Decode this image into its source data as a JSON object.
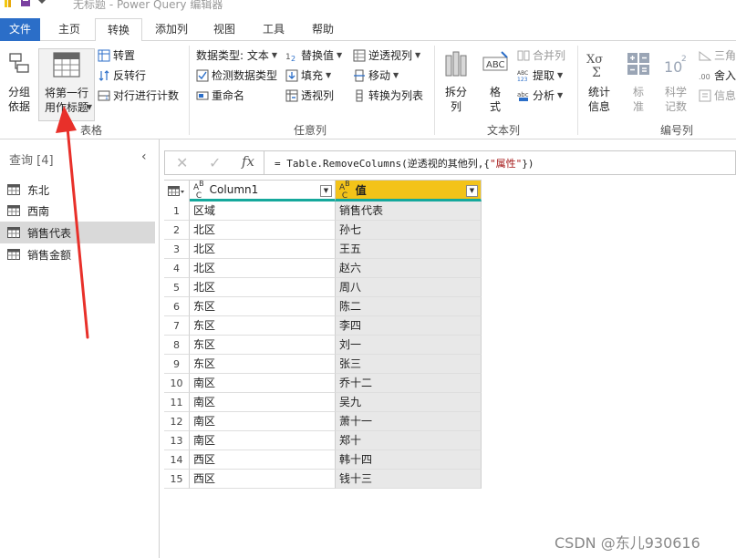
{
  "window": {
    "title": "无标题 - Power Query 编辑器"
  },
  "tabs": [
    {
      "label": "文件"
    },
    {
      "label": "主页"
    },
    {
      "label": "转换"
    },
    {
      "label": "添加列"
    },
    {
      "label": "视图"
    },
    {
      "label": "工具"
    },
    {
      "label": "帮助"
    }
  ],
  "ribbon": {
    "table_group": {
      "label": "表格",
      "group_by": "分组\n依据",
      "use_first_row": "将第一行\n用作标题",
      "transpose": "转置",
      "reverse_rows": "反转行",
      "count_rows": "对行进行计数"
    },
    "any_column_group": {
      "label": "任意列",
      "data_type": "数据类型: 文本",
      "detect_type": "检测数据类型",
      "rename": "重命名",
      "replace_values": "替换值",
      "fill": "填充",
      "pivot": "透视列",
      "unpivot": "逆透视列",
      "move": "移动",
      "to_list": "转换为列表"
    },
    "text_column_group": {
      "label": "文本列",
      "split": "拆分\n列",
      "format": "格\n式",
      "merge": "合并列",
      "extract": "提取",
      "parse": "分析"
    },
    "number_column_group": {
      "label": "编号列",
      "stats": "统计\n信息",
      "standard": "标\n准",
      "scientific": "科学\n记数",
      "trig": "三角",
      "round": "舍入",
      "info": "信息"
    }
  },
  "queries": {
    "title": "查询 [4]",
    "items": [
      {
        "label": "东北",
        "selected": false
      },
      {
        "label": "西南",
        "selected": false
      },
      {
        "label": "销售代表",
        "selected": true
      },
      {
        "label": "销售金额",
        "selected": false
      }
    ]
  },
  "formula": {
    "prefix": "= Table.RemoveColumns(逆透视的其他列,{",
    "string": "\"属性\"",
    "suffix": "})"
  },
  "grid": {
    "columns": [
      "Column1",
      "值"
    ],
    "rows": [
      {
        "n": "1",
        "c1": "区域",
        "c2": "销售代表"
      },
      {
        "n": "2",
        "c1": "北区",
        "c2": "孙七"
      },
      {
        "n": "3",
        "c1": "北区",
        "c2": "王五"
      },
      {
        "n": "4",
        "c1": "北区",
        "c2": "赵六"
      },
      {
        "n": "5",
        "c1": "北区",
        "c2": "周八"
      },
      {
        "n": "6",
        "c1": "东区",
        "c2": "陈二"
      },
      {
        "n": "7",
        "c1": "东区",
        "c2": "李四"
      },
      {
        "n": "8",
        "c1": "东区",
        "c2": "刘一"
      },
      {
        "n": "9",
        "c1": "东区",
        "c2": "张三"
      },
      {
        "n": "10",
        "c1": "南区",
        "c2": "乔十二"
      },
      {
        "n": "11",
        "c1": "南区",
        "c2": "吴九"
      },
      {
        "n": "12",
        "c1": "南区",
        "c2": "萧十一"
      },
      {
        "n": "13",
        "c1": "南区",
        "c2": "郑十"
      },
      {
        "n": "14",
        "c1": "西区",
        "c2": "韩十四"
      },
      {
        "n": "15",
        "c1": "西区",
        "c2": "钱十三"
      }
    ]
  },
  "watermark": "CSDN @东儿930616",
  "colors": {
    "accent": "#2b6ec8",
    "value_header": "#f3c319",
    "header_underline": "#15a89c",
    "annotation": "#e8302a"
  }
}
